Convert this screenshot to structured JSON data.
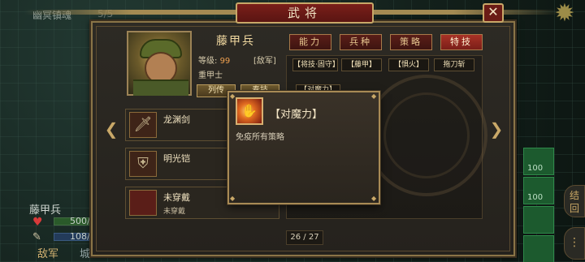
{
  "background": {
    "top_left_text": "幽冥镇魂",
    "top_left_text2": "5/5"
  },
  "title": "武将",
  "close_label": "✕",
  "general": {
    "name": "藤甲兵",
    "level_label": "等级:",
    "level": "99",
    "faction": "[敌军]",
    "unit_type": "重甲士",
    "biography_button": "列传",
    "other_button": "奏技"
  },
  "tabs": [
    "能力",
    "兵种",
    "策略",
    "特技"
  ],
  "active_tab": "特技",
  "traits": [
    "【将技·固守】",
    "【藤甲】",
    "【惧火】",
    "拖刀斩"
  ],
  "traits_row2": "【对魔力】",
  "equipment": [
    {
      "name": "龙渊剑",
      "sub": "",
      "icon": "sword-icon"
    },
    {
      "name": "明光铠",
      "sub": "",
      "icon": "armor-icon"
    },
    {
      "name": "未穿戴",
      "sub": "未穿戴",
      "icon": "empty-slot-icon"
    }
  ],
  "page": "26 / 27",
  "popup": {
    "title": "【对魔力】",
    "description": "免疫所有策略"
  },
  "bottom_left": {
    "name": "藤甲兵",
    "hp": "500/",
    "mp": "108/",
    "enemy": "敌军",
    "small": "城"
  },
  "right_side": {
    "tile_1": "100",
    "tile_2": "100",
    "round_text": "结\n回"
  }
}
